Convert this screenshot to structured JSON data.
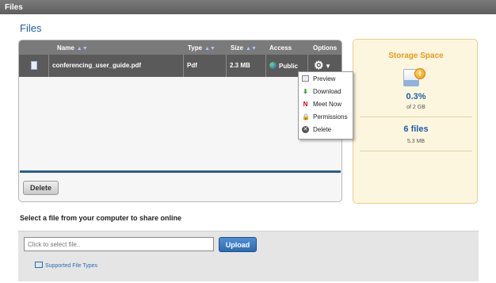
{
  "window": {
    "title": "Files"
  },
  "page": {
    "title": "Files"
  },
  "table": {
    "headers": {
      "name": "Name",
      "type": "Type",
      "size": "Size",
      "access": "Access",
      "options": "Options"
    },
    "rows": [
      {
        "name": "conferencing_user_guide.pdf",
        "type": "Pdf",
        "size": "2.3 MB",
        "access": "Public"
      }
    ],
    "delete_label": "Delete"
  },
  "options_menu": {
    "items": [
      {
        "label": "Preview",
        "icon": "preview-icon"
      },
      {
        "label": "Download",
        "icon": "download-arrow-icon"
      },
      {
        "label": "Meet Now",
        "icon": "meet-now-icon"
      },
      {
        "label": "Permissions",
        "icon": "lock-icon"
      },
      {
        "label": "Delete",
        "icon": "delete-x-icon"
      }
    ]
  },
  "storage": {
    "title": "Storage Space",
    "percent": "0.3%",
    "used_fraction": 0.003,
    "of_total": "of 2 GB",
    "files_count": "6 files",
    "files_size": "5.3 MB",
    "warning_glyph": "!"
  },
  "upload": {
    "label": "Select a file from your computer to share online",
    "placeholder": "Click to select file..",
    "button_label": "Upload",
    "supported_link": "Supported File Types"
  },
  "colors": {
    "accent": "#1f5fa8",
    "storage_title": "#e89a1a",
    "header_bg": "#7a7a7a"
  }
}
